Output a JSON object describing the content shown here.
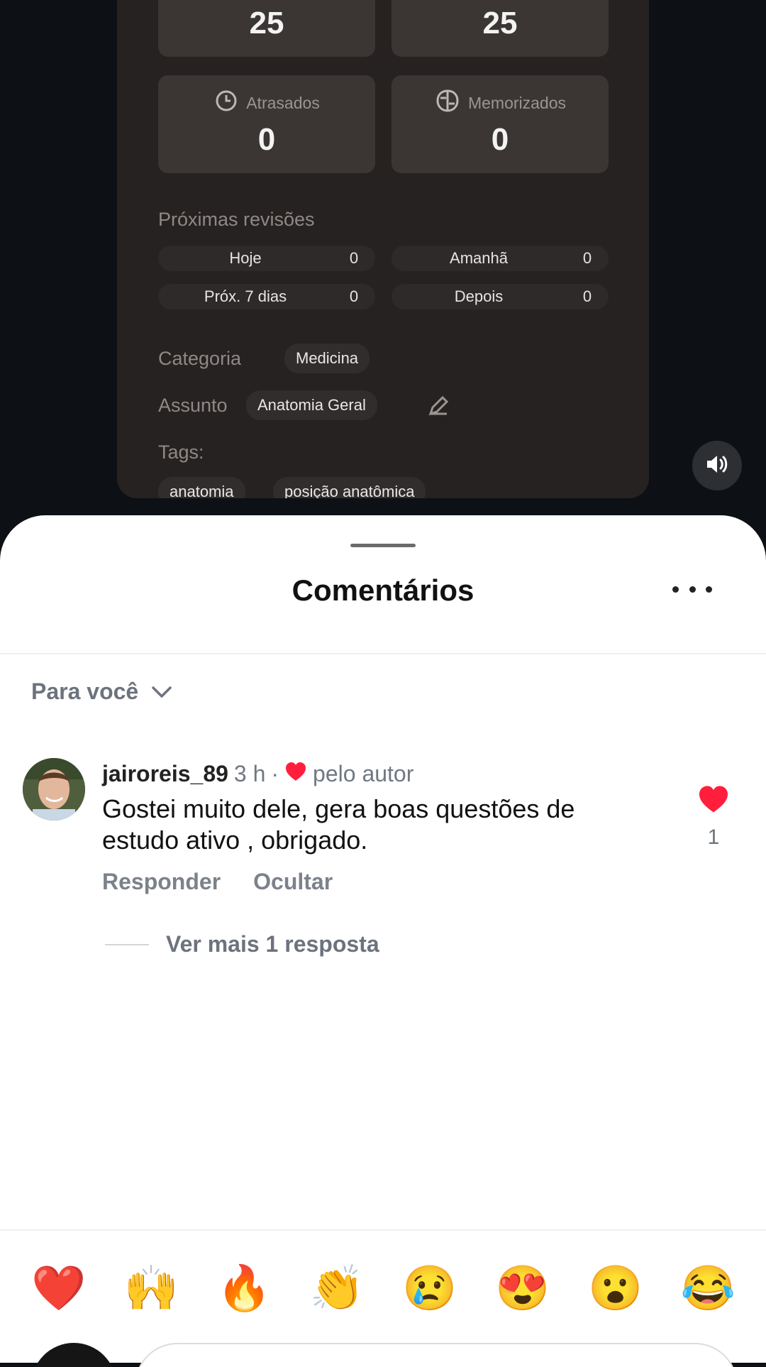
{
  "video": {
    "top_stats": [
      {
        "value": "25"
      },
      {
        "value": "25"
      }
    ],
    "stats": [
      {
        "label": "Atrasados",
        "value": "0",
        "icon": "clock-alert-icon"
      },
      {
        "label": "Memorizados",
        "value": "0",
        "icon": "brain-icon"
      }
    ],
    "reviews_title": "Próximas revisões",
    "reviews": [
      {
        "label": "Hoje",
        "value": "0"
      },
      {
        "label": "Amanhã",
        "value": "0"
      },
      {
        "label": "Próx. 7 dias",
        "value": "0"
      },
      {
        "label": "Depois",
        "value": "0"
      }
    ],
    "category_label": "Categoria",
    "category_value": "Medicina",
    "subject_label": "Assunto",
    "subject_value": "Anatomia Geral",
    "tags_label": "Tags:",
    "tags": [
      "anatomia",
      "posição anatômica"
    ]
  },
  "sheet": {
    "title": "Comentários",
    "filter_label": "Para você"
  },
  "comment": {
    "username": "jairoreis_89",
    "time": "3 h",
    "separator": "·",
    "liked_by_author": "pelo autor",
    "text": "Gostei muito dele, gera boas questões de estudo ativo , obrigado.",
    "reply_label": "Responder",
    "hide_label": "Ocultar",
    "like_count": "1"
  },
  "replies": {
    "more_label": "Ver mais 1 resposta"
  },
  "emoji_bar": [
    "❤️",
    "🙌",
    "🔥",
    "👏",
    "😢",
    "😍",
    "😮",
    "😂"
  ],
  "colors": {
    "like_red": "#ff1f3d",
    "sheet_bg": "#ffffff",
    "video_bg": "#0d1014"
  }
}
